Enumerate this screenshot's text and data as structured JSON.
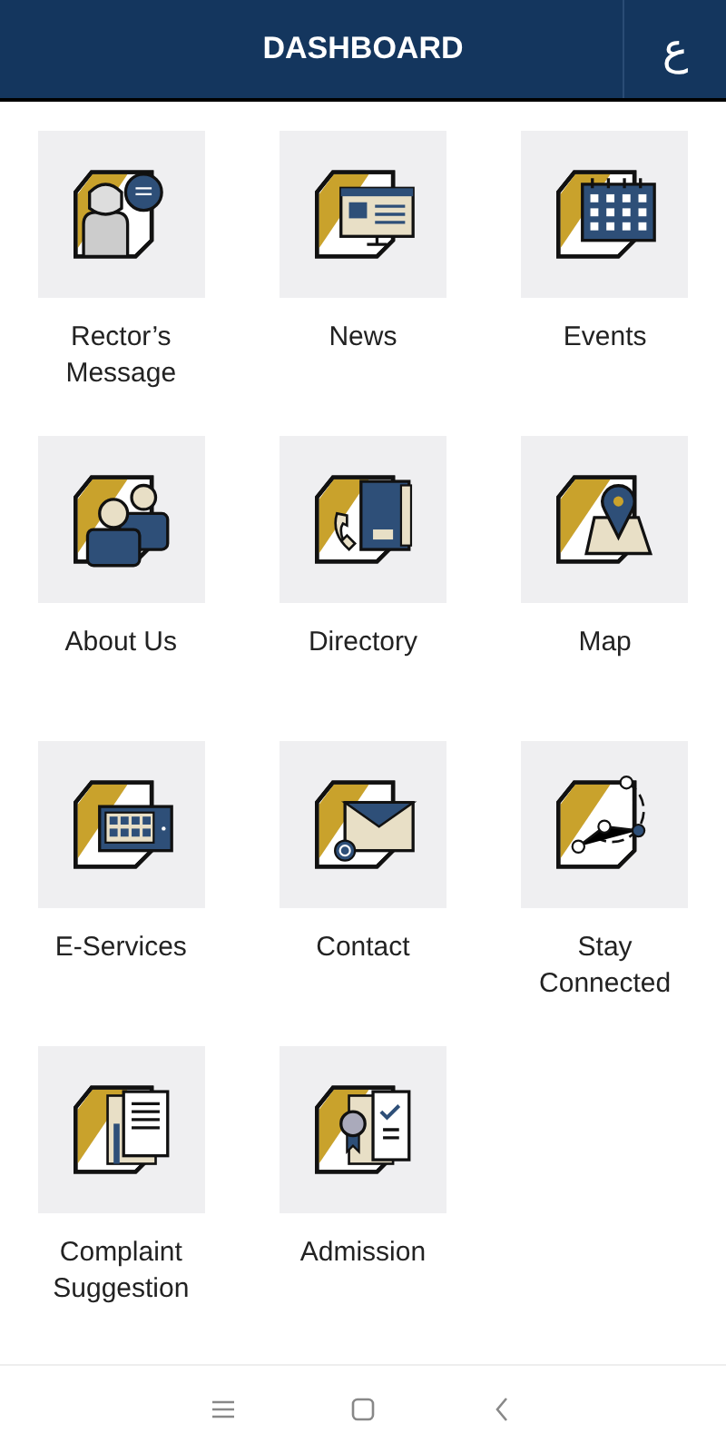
{
  "header": {
    "title": "DASHBOARD",
    "language_button": "ع"
  },
  "tiles": [
    {
      "label": "Rector’s Message"
    },
    {
      "label": "News"
    },
    {
      "label": "Events"
    },
    {
      "label": "About Us"
    },
    {
      "label": "Directory"
    },
    {
      "label": "Map"
    },
    {
      "label": "E-Services"
    },
    {
      "label": "Contact"
    },
    {
      "label": "Stay Connected"
    },
    {
      "label": "Complaint Suggestion"
    },
    {
      "label": "Admission"
    }
  ]
}
